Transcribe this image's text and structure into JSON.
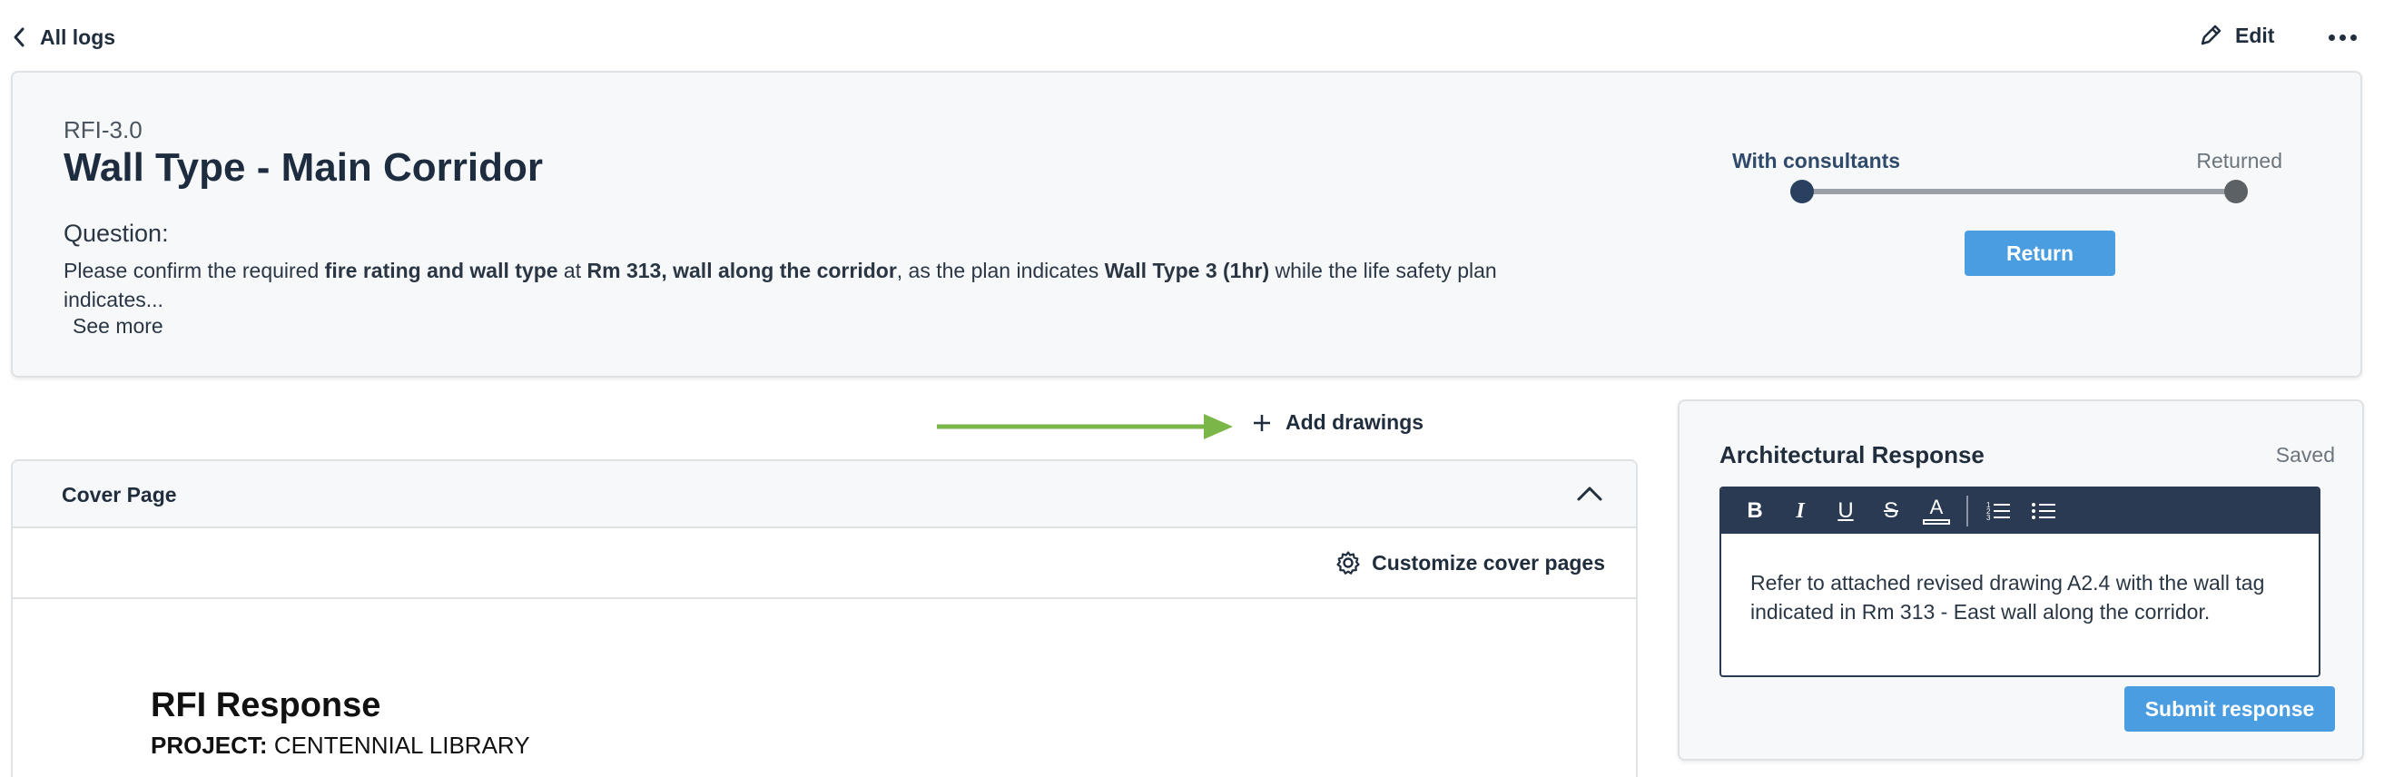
{
  "nav": {
    "back_label": "All logs",
    "edit_label": "Edit"
  },
  "rfi": {
    "number": "RFI-3.0",
    "title": "Wall Type - Main Corridor",
    "question_label": "Question:",
    "question_parts": [
      {
        "text": "Please confirm the required ",
        "bold": false
      },
      {
        "text": "fire rating and wall type",
        "bold": true
      },
      {
        "text": " at ",
        "bold": false
      },
      {
        "text": "Rm 313, wall along the corridor",
        "bold": true
      },
      {
        "text": ", as the plan indicates ",
        "bold": false
      },
      {
        "text": "Wall Type 3 (1hr)",
        "bold": true
      },
      {
        "text": " while the life safety plan indicates...",
        "bold": false
      }
    ],
    "see_more": "See more"
  },
  "status": {
    "current": "With consultants",
    "next": "Returned",
    "return_label": "Return"
  },
  "add_drawings_label": "Add drawings",
  "annotation": {
    "arrow_color": "#7ab648"
  },
  "cover": {
    "header": "Cover Page",
    "customize_label": "Customize cover pages",
    "doc_title": "RFI Response",
    "project_label": "PROJECT:",
    "project_name": "CENTENNIAL LIBRARY"
  },
  "response": {
    "title": "Architectural Response",
    "status": "Saved",
    "toolbar": [
      {
        "icon": "bold-icon",
        "glyph": "B"
      },
      {
        "icon": "italic-icon",
        "glyph": "I"
      },
      {
        "icon": "underline-icon",
        "glyph": "U"
      },
      {
        "icon": "strikethrough-icon",
        "glyph": "S"
      },
      {
        "icon": "text-color-icon",
        "glyph": "A"
      },
      {
        "icon": "numbered-list-icon",
        "glyph": ""
      },
      {
        "icon": "bulleted-list-icon",
        "glyph": ""
      }
    ],
    "body": "Refer to attached revised drawing A2.4 with the wall tag indicated in Rm 313 - East wall along the corridor.",
    "submit_label": "Submit response"
  },
  "colors": {
    "accent": "#4a9de0",
    "navy": "#2a3a52",
    "card_bg": "#f7f8f9"
  }
}
